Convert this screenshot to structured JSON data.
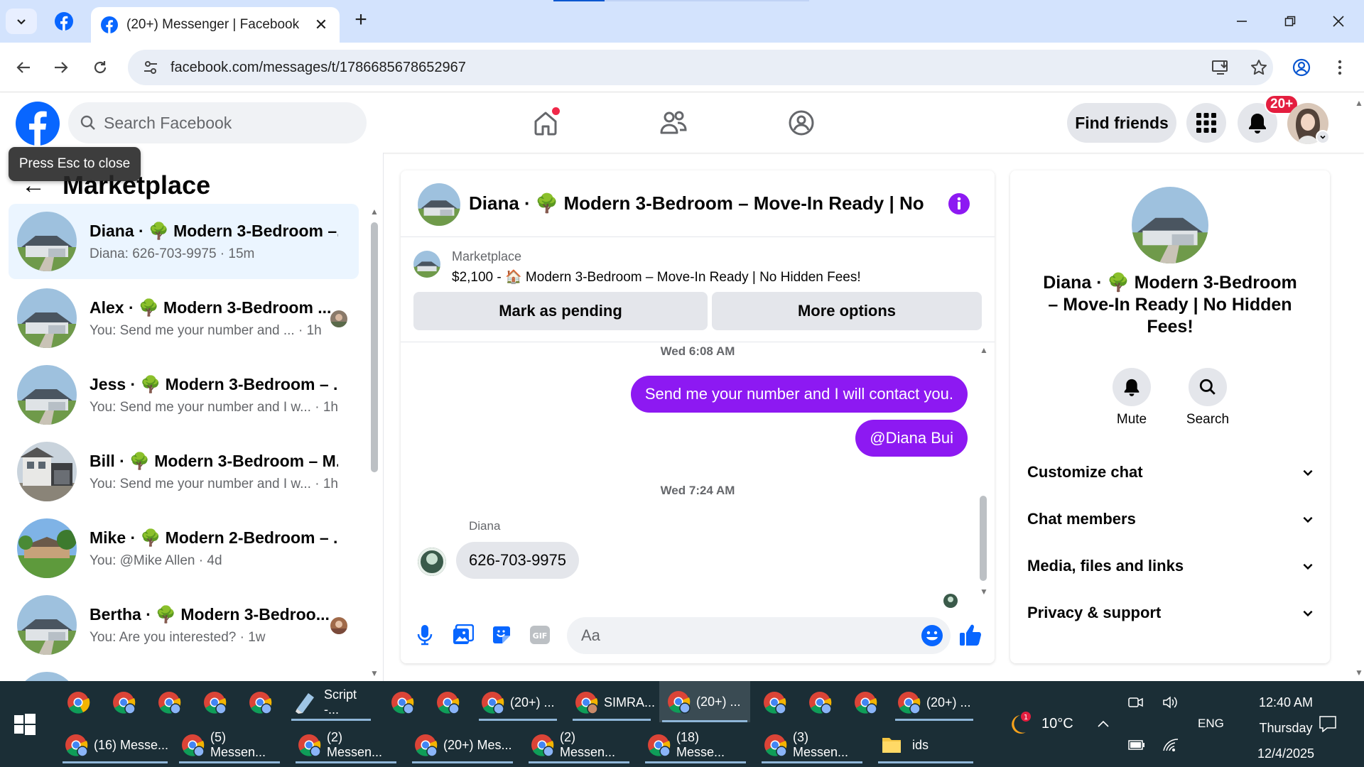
{
  "browser": {
    "active_tab_title": "(20+) Messenger | Facebook",
    "url": "facebook.com/messages/t/1786685678652967"
  },
  "fb": {
    "search_placeholder": "Search Facebook",
    "find_friends": "Find friends",
    "notif_badge": "20+",
    "tooltip": "Press Esc to close",
    "accent": "#0866ff"
  },
  "sidebar": {
    "title": "Marketplace",
    "conversations": [
      {
        "name": "Diana · 🌳 Modern 3-Bedroom –...",
        "preview": "Diana: 626-703-9975 · 15m"
      },
      {
        "name": "Alex · 🌳 Modern 3-Bedroom ...",
        "preview": "You: Send me your number and ... · 1h"
      },
      {
        "name": "Jess · 🌳 Modern 3-Bedroom – ...",
        "preview": "You: Send me your number and I w... · 1h"
      },
      {
        "name": "Bill · 🌳 Modern 3-Bedroom – M...",
        "preview": "You: Send me your number and I w... · 1h"
      },
      {
        "name": "Mike · 🌳 Modern 2-Bedroom – ...",
        "preview": "You: @Mike Allen · 4d"
      },
      {
        "name": "Bertha · 🌳 Modern 3-Bedroo...",
        "preview": "You: Are you interested? · 1w"
      }
    ]
  },
  "chat": {
    "title": "Diana · 🌳 Modern 3-Bedroom – Move-In Ready | No ...",
    "listing_source": "Marketplace",
    "listing_desc": "$2,100 - 🏠 Modern 3-Bedroom – Move-In Ready | No Hidden Fees!",
    "mark_pending": "Mark as pending",
    "more_options": "More options",
    "ts1": "Wed 6:08 AM",
    "msg_out_1": "Send me your number and I will contact you.",
    "msg_out_2": "@Diana Bui",
    "ts2": "Wed 7:24 AM",
    "sender": "Diana",
    "msg_in_1": "626-703-9975",
    "composer_placeholder": "Aa",
    "bubble_color": "#8d19f2"
  },
  "info": {
    "title": "Diana · 🌳 Modern 3-Bedroom – Move-In Ready | No Hidden Fees!",
    "mute": "Mute",
    "search": "Search",
    "sections": [
      "Customize chat",
      "Chat members",
      "Media, files and links",
      "Privacy & support"
    ]
  },
  "taskbar": {
    "row1": [
      "",
      "",
      "",
      "",
      "",
      "Script -...",
      "",
      "",
      "(20+) ...",
      "SIMRA...",
      "(20+) ...",
      "",
      "",
      "",
      "(20+) ..."
    ],
    "row2": [
      "(16) Messe...",
      "(5) Messen...",
      "(2) Messen...",
      "(20+) Mes...",
      "(2) Messen...",
      "(18) Messe...",
      "(3) Messen...",
      "ids"
    ],
    "weather": "10°C",
    "weather_badge": "1",
    "lang": "ENG",
    "time": "12:40 AM",
    "day": "Thursday",
    "date": "12/4/2025"
  }
}
